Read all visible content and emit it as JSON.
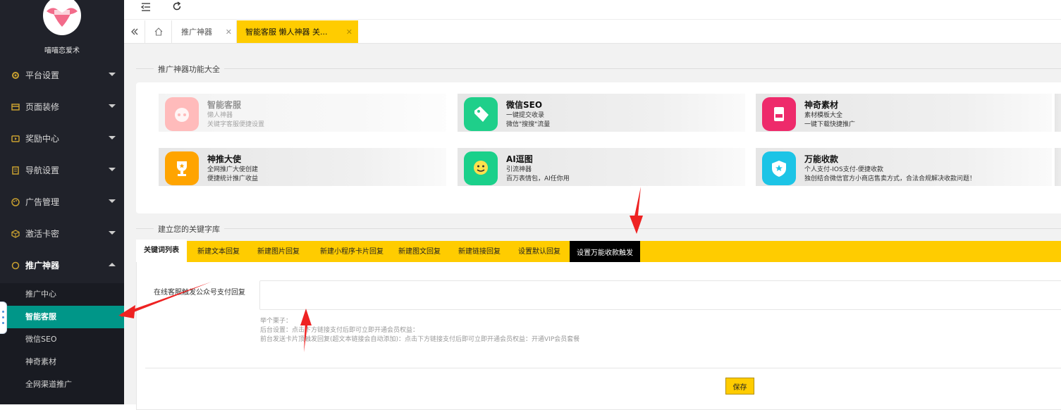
{
  "sidebar": {
    "site_name": "喵喵恋爱术",
    "menu": [
      {
        "label": "平台设置",
        "icon": "gear-icon"
      },
      {
        "label": "页面装修",
        "icon": "layout-icon"
      },
      {
        "label": "奖励中心",
        "icon": "video-icon"
      },
      {
        "label": "导航设置",
        "icon": "book-icon"
      },
      {
        "label": "广告管理",
        "icon": "palette-icon"
      },
      {
        "label": "激活卡密",
        "icon": "cube-icon"
      },
      {
        "label": "推广神器",
        "icon": "circle-icon"
      }
    ],
    "submenu": [
      "推广中心",
      "智能客服",
      "微信SEO",
      "神奇素材",
      "全网渠道推广"
    ]
  },
  "tabs": {
    "first": "推广神器",
    "active": "智能客服 懒人神器 关..."
  },
  "section1": {
    "title": "推广神器功能大全"
  },
  "cards": [
    {
      "title": "智能客服",
      "line1": "懒人神器",
      "line2": "关键字客服便捷设置",
      "color": "#ff6b6b",
      "icon": "chat-bot-icon"
    },
    {
      "title": "微信SEO",
      "line1": "一键提交收录",
      "line2": "微信\"搜搜\"流量",
      "color": "#1fcf8a",
      "icon": "seo-tag-icon"
    },
    {
      "title": "神奇素材",
      "line1": "素材模板大全",
      "line2": "一键下载快捷推广",
      "color": "#ee2a6b",
      "icon": "red-packet-icon"
    },
    {
      "title": "神推大使",
      "line1": "全网推广大使创建",
      "line2": "便捷统计推广收益",
      "color": "#ffa400",
      "icon": "trophy-icon"
    },
    {
      "title": "AI逗图",
      "line1": "引流神器",
      "line2": "百万表情包，AI任你用",
      "color": "#1ad08a",
      "icon": "emoji-icon"
    },
    {
      "title": "万能收款",
      "line1": "个人支付-IOS支付-便捷收款",
      "line2": "独创结合微信官方小商店售卖方式，合法合规解决收款问题！",
      "color": "#1cc4e6",
      "icon": "shield-star-icon"
    }
  ],
  "section2": {
    "title": "建立您的关键字库"
  },
  "keyword_tabs": [
    "关键词列表",
    "新建文本回复",
    "新建图片回复",
    "新建小程序卡片回复",
    "新建图文回复",
    "新建链接回复",
    "设置默认回复",
    "设置万能收款触发"
  ],
  "form": {
    "label": "在线客服触发公众号支付回复",
    "value": "",
    "hint_title": "举个栗子：",
    "hint_1": "后台设置：点击下方链接支付后即可立即开通会员权益：",
    "hint_2": "前台发送卡片顶触发回复(超文本链接会自动添加)：点击下方链接支付后即可立即开通会员权益：开通VIP会员套餐",
    "save_label": "保存"
  },
  "colors": {
    "sidebar_bg": "#20222a",
    "accent_teal": "#009688",
    "accent_yellow": "#ffcc00",
    "annotation_red": "#ee2222"
  }
}
